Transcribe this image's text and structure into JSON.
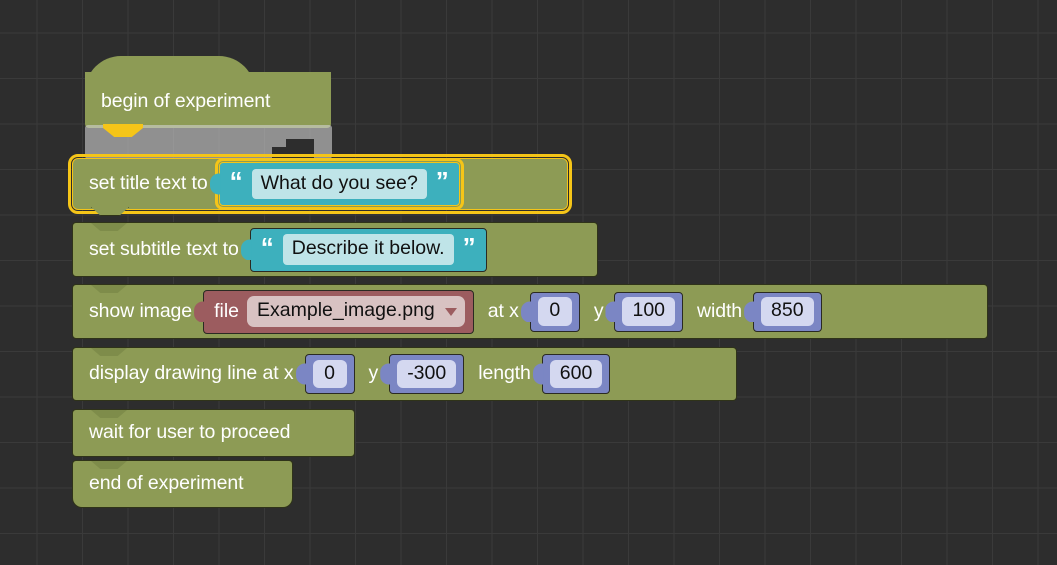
{
  "workspace": {
    "background_color": "#2d2d2d",
    "grid_color": "#3a3a3a",
    "block_color": "#8d9b55",
    "string_block_color": "#3db0bd",
    "number_block_color": "#7b86c4",
    "file_block_color": "#9c5c5f",
    "selection_color": "#f5c518"
  },
  "blocks": {
    "hat": {
      "label": "begin of experiment"
    },
    "insertion_marker": {
      "label": ""
    },
    "set_title": {
      "label": "set title text to",
      "value": "What do you see?",
      "quote_open": "“",
      "quote_close": "”",
      "selected": true
    },
    "set_subtitle": {
      "label": "set subtitle text to",
      "value": "Describe it below.",
      "quote_open": "“",
      "quote_close": "”",
      "selected": false
    },
    "show_image": {
      "label": "show image",
      "file_label": "file",
      "file_value": "Example_image.png",
      "at_x_label": "at x",
      "x_value": "0",
      "y_label": "y",
      "y_value": "100",
      "width_label": "width",
      "width_value": "850"
    },
    "drawing_line": {
      "label": "display drawing line at x",
      "x_value": "0",
      "y_label": "y",
      "y_value": "-300",
      "length_label": "length",
      "length_value": "600"
    },
    "wait_user": {
      "label": "wait for user to proceed"
    },
    "end": {
      "label": "end of experiment"
    }
  }
}
